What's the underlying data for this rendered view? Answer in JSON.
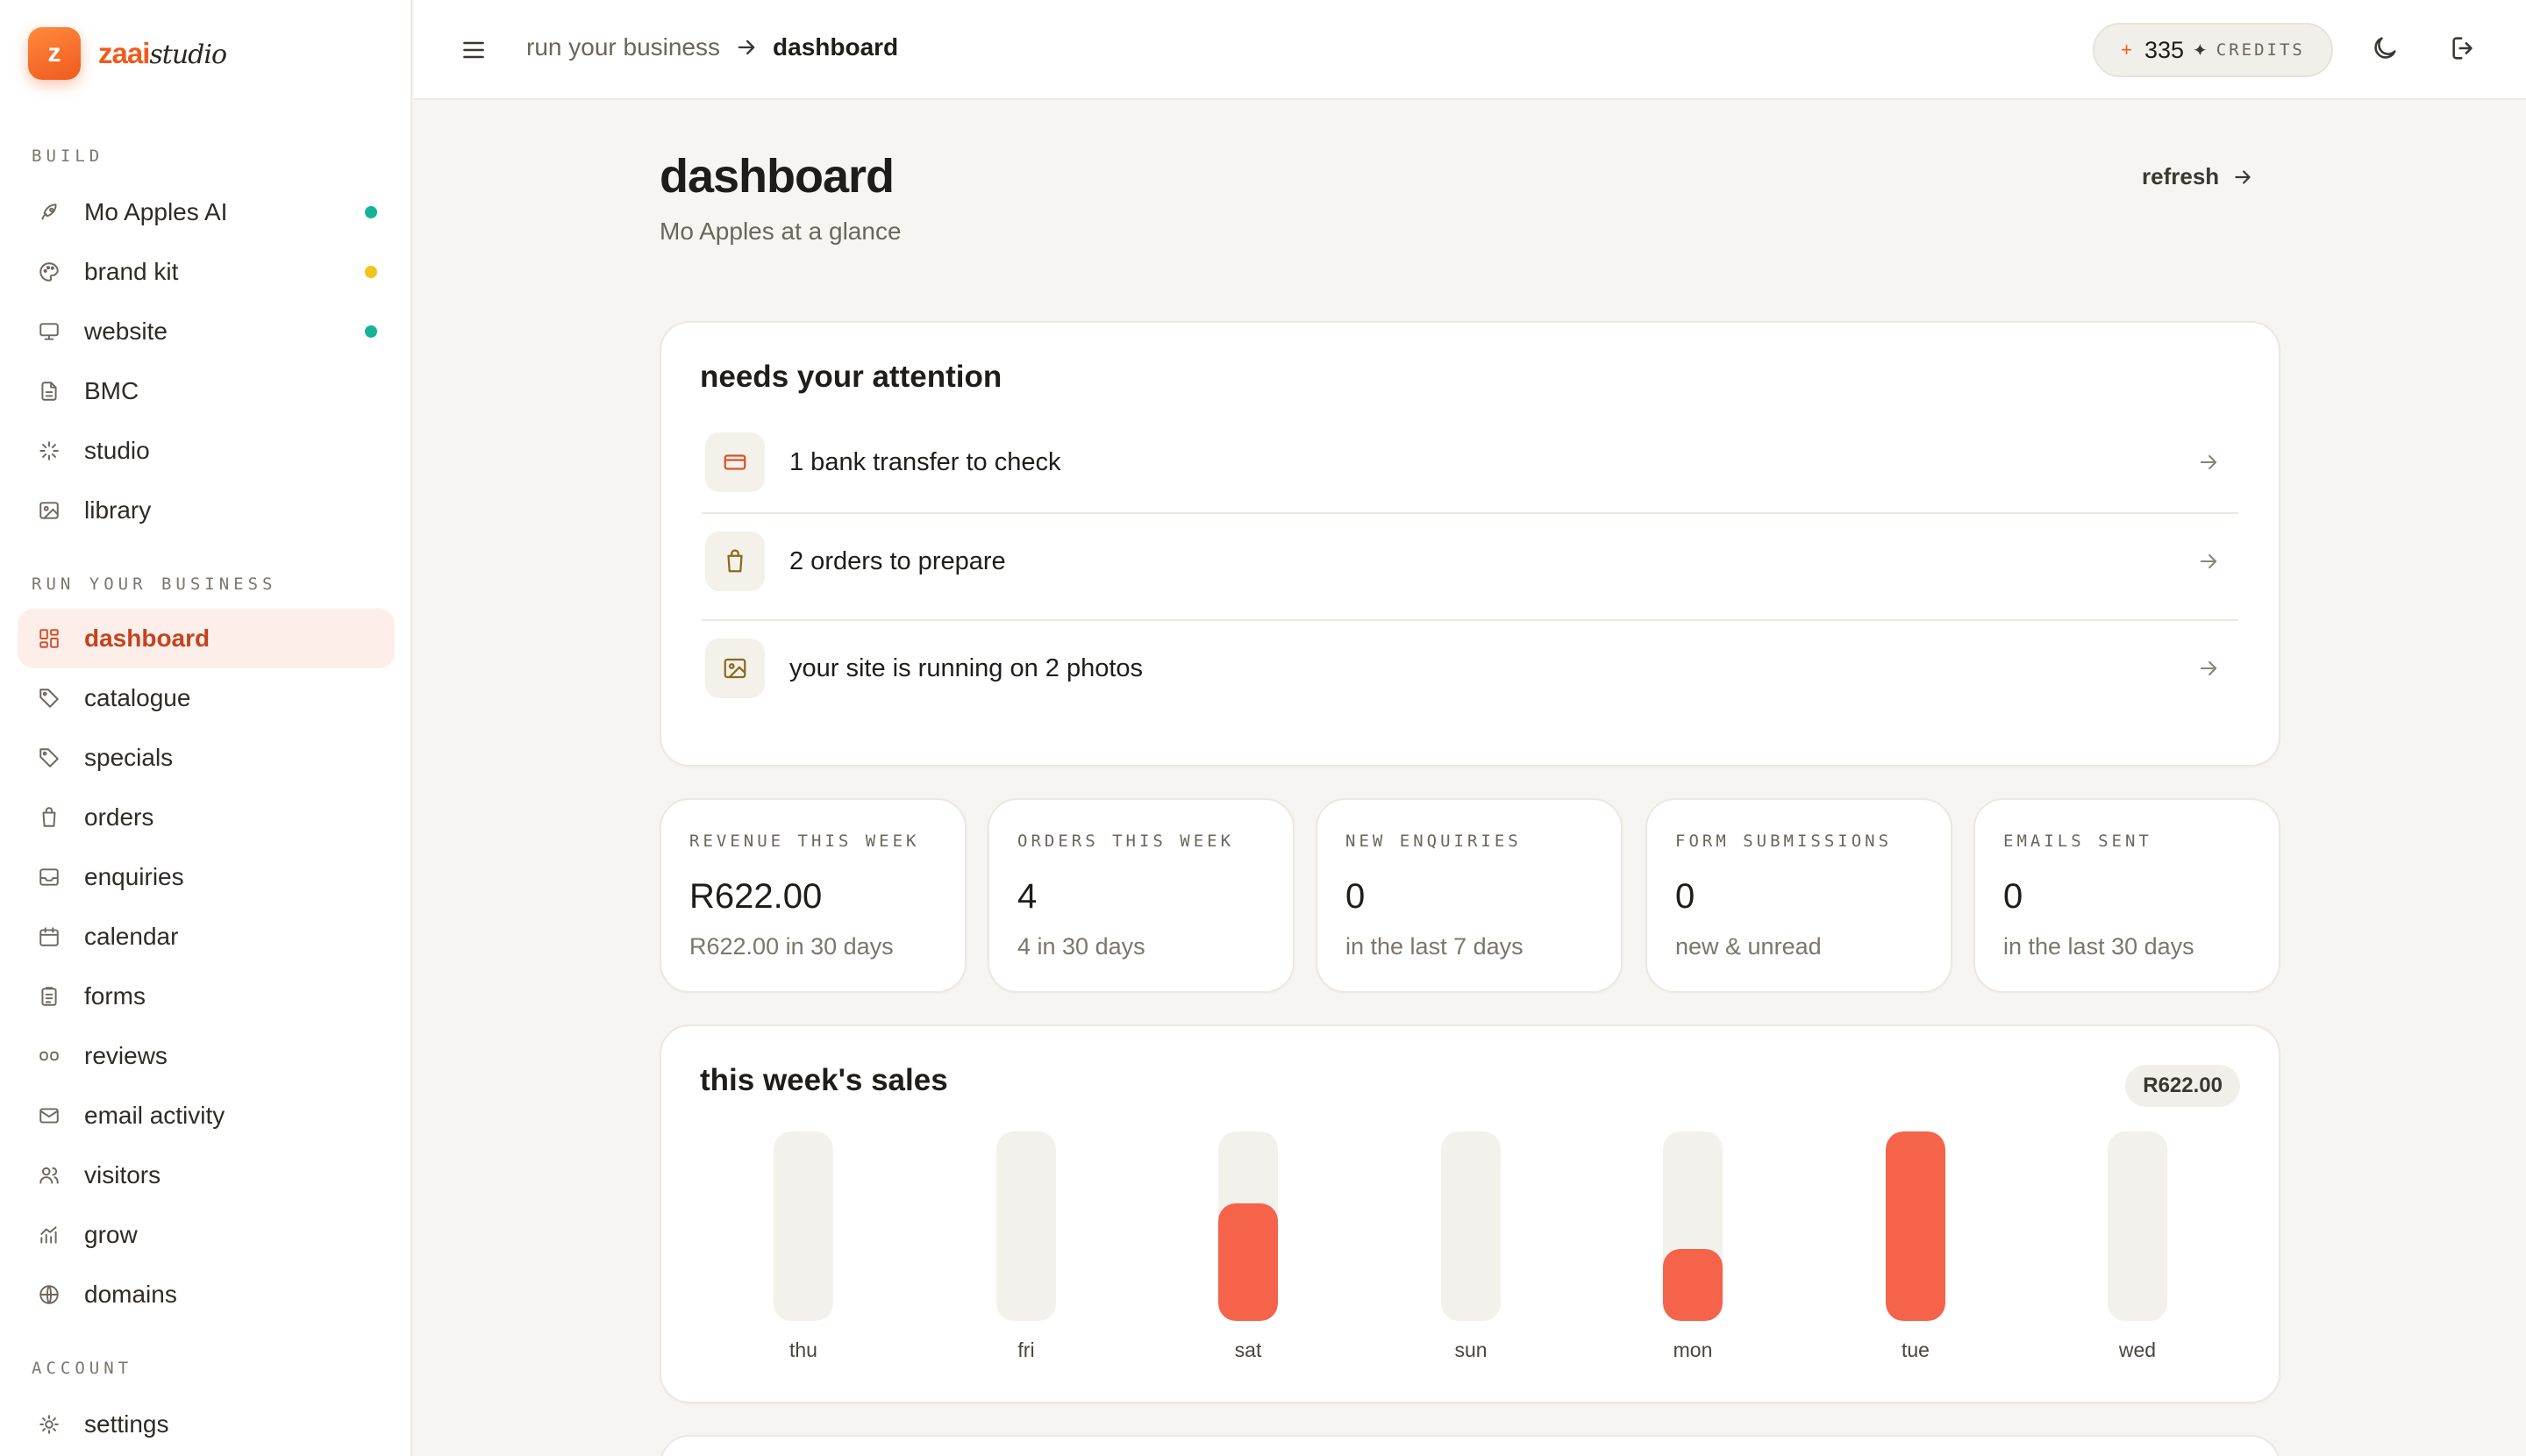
{
  "brand": {
    "logo_letter": "z",
    "name": "zaai",
    "suffix": "studio"
  },
  "sidebar": {
    "sections": [
      {
        "label": "BUILD"
      },
      {
        "label": "RUN YOUR BUSINESS"
      },
      {
        "label": "ACCOUNT"
      }
    ],
    "items": [
      {
        "label": "Mo Apples AI",
        "icon": "rocket-icon",
        "status_color": "#14b39a"
      },
      {
        "label": "brand kit",
        "icon": "palette-icon",
        "status_color": "#f2c318"
      },
      {
        "label": "website",
        "icon": "monitor-icon",
        "status_color": "#14b39a"
      },
      {
        "label": "BMC",
        "icon": "document-icon"
      },
      {
        "label": "studio",
        "icon": "sparkle-icon"
      },
      {
        "label": "library",
        "icon": "image-icon"
      },
      {
        "label": "dashboard",
        "icon": "grid-icon",
        "active": true
      },
      {
        "label": "catalogue",
        "icon": "tag-icon"
      },
      {
        "label": "specials",
        "icon": "tag-icon"
      },
      {
        "label": "orders",
        "icon": "shopping-bag-icon"
      },
      {
        "label": "enquiries",
        "icon": "inbox-icon"
      },
      {
        "label": "calendar",
        "icon": "calendar-icon"
      },
      {
        "label": "forms",
        "icon": "clipboard-icon"
      },
      {
        "label": "reviews",
        "icon": "quote-icon"
      },
      {
        "label": "email activity",
        "icon": "mail-icon"
      },
      {
        "label": "visitors",
        "icon": "users-icon"
      },
      {
        "label": "grow",
        "icon": "growth-chart-icon"
      },
      {
        "label": "domains",
        "icon": "globe-icon"
      },
      {
        "label": "settings",
        "icon": "sun-gear-icon"
      }
    ]
  },
  "topbar": {
    "breadcrumb_parent": "run your business",
    "breadcrumb_current": "dashboard",
    "credits_value": "335",
    "credits_label": "CREDITS"
  },
  "main": {
    "title": "dashboard",
    "subtitle": "Mo Apples at a glance",
    "refresh_label": "refresh"
  },
  "attention": {
    "title": "needs your attention",
    "items": [
      {
        "text": "1 bank transfer to check",
        "icon": "credit-card-icon",
        "icon_color": "#d9532b"
      },
      {
        "text": "2 orders to prepare",
        "icon": "shopping-bag-icon",
        "icon_color": "#8a6a1a"
      },
      {
        "text": "your site is running on 2 photos",
        "icon": "image-icon",
        "icon_color": "#8a6a1a"
      }
    ]
  },
  "stats": [
    {
      "label": "REVENUE THIS WEEK",
      "value": "R622.00",
      "sub": "R622.00 in 30 days"
    },
    {
      "label": "ORDERS THIS WEEK",
      "value": "4",
      "sub": "4 in 30 days"
    },
    {
      "label": "NEW ENQUIRIES",
      "value": "0",
      "sub": "in the last 7 days"
    },
    {
      "label": "FORM SUBMISSIONS",
      "value": "0",
      "sub": "new & unread"
    },
    {
      "label": "EMAILS SENT",
      "value": "0",
      "sub": "in the last 30 days"
    }
  ],
  "sales": {
    "title": "this week's sales",
    "total_badge": "R622.00",
    "bar_color": "#f4634a"
  },
  "chart_data": {
    "type": "bar",
    "categories": [
      "thu",
      "fri",
      "sat",
      "sun",
      "mon",
      "tue",
      "wed"
    ],
    "values": [
      0,
      0,
      0.62,
      0,
      0.38,
      1,
      0
    ],
    "note": "values are fraction of the week's max day (bar fill level)",
    "ylim": [
      0,
      1
    ]
  }
}
